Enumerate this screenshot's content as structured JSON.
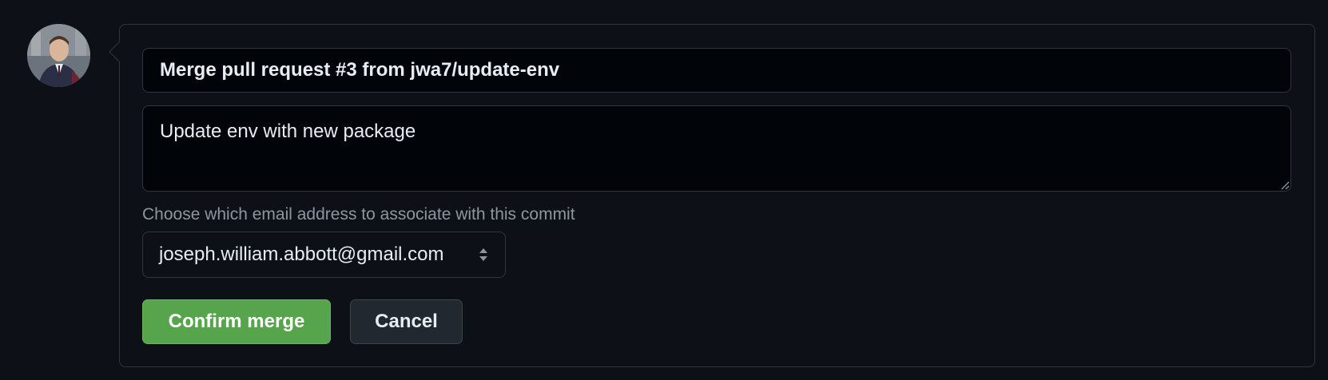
{
  "merge_form": {
    "commit_title": "Merge pull request #3 from jwa7/update-env",
    "commit_body": "Update env with new package",
    "email_label": "Choose which email address to associate with this commit",
    "email_selected": "joseph.william.abbott@gmail.com",
    "confirm_label": "Confirm merge",
    "cancel_label": "Cancel"
  },
  "colors": {
    "background": "#0d1117",
    "input_background": "#010409",
    "border": "#30363d",
    "confirm_green": "#56a54c",
    "cancel_background": "#212830",
    "muted_text": "#8d96a0"
  },
  "icons": {
    "avatar": "user-avatar",
    "select": "chevron-up-down-icon",
    "resize": "resize-handle-icon"
  }
}
